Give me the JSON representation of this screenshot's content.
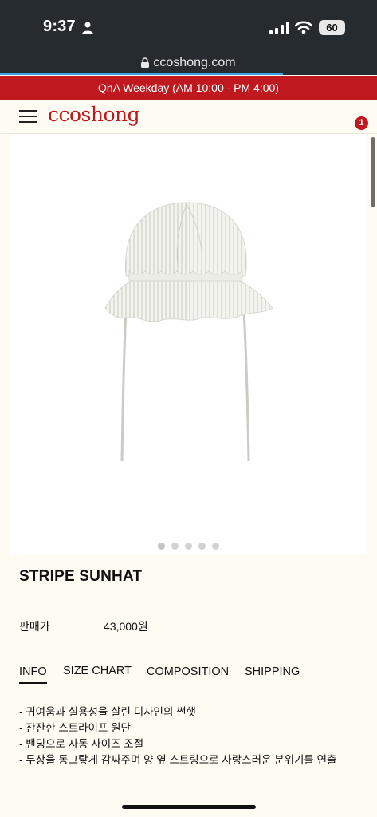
{
  "status_bar": {
    "time": "9:37",
    "battery": "60"
  },
  "browser": {
    "url": "ccoshong.com",
    "load_progress": 0.75
  },
  "notice": {
    "text": "QnA Weekday (AM 10:00 - PM 4:00)"
  },
  "header": {
    "logo": "ccoshong",
    "cart_count": "1",
    "brand_color": "#c0181f"
  },
  "carousel": {
    "slides": 5,
    "active_index": 0
  },
  "product": {
    "title": "STRIPE SUNHAT",
    "price_label": "판매가",
    "price_value": "43,000원"
  },
  "tabs": [
    {
      "label": "INFO",
      "active": true
    },
    {
      "label": "SIZE CHART",
      "active": false
    },
    {
      "label": "COMPOSITION",
      "active": false
    },
    {
      "label": "SHIPPING",
      "active": false
    }
  ],
  "description": [
    "- 귀여움과 실용성을 살린 디자인의 썬햇",
    "- 잔잔한 스트라이프 원단",
    "- 밴딩으로 자동 사이즈 조절",
    "- 두상을 동그랗게 감싸주며 양 옆 스트링으로 사랑스러운 분위기를 연출"
  ]
}
